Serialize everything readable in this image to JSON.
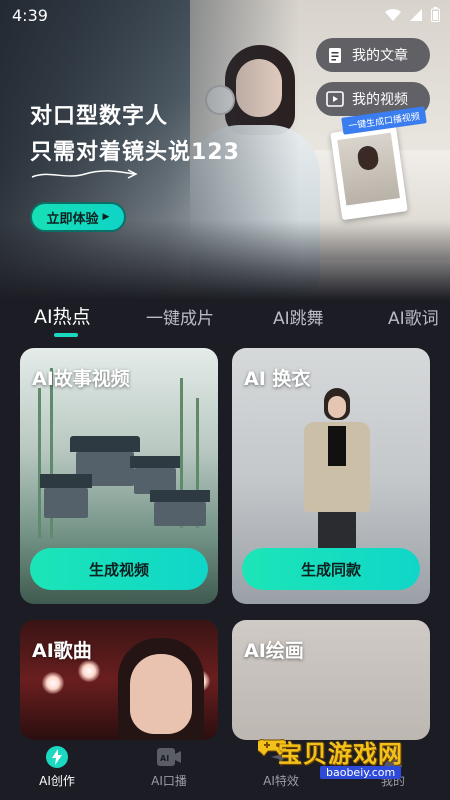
{
  "status_bar": {
    "time": "4:39"
  },
  "hero": {
    "title_line1": "对口型数字人",
    "title_line2": "只需对着镜头说123",
    "cta_label": "立即体验",
    "pill_articles": "我的文章",
    "pill_videos": "我的视频",
    "promo_ribbon": "一键生成口播视频"
  },
  "tabs": [
    {
      "label": "AI热点"
    },
    {
      "label": "一键成片"
    },
    {
      "label": "AI跳舞"
    },
    {
      "label": "AI歌词"
    }
  ],
  "cards": {
    "story": {
      "title": "AI故事视频",
      "button": "生成视频"
    },
    "cloth": {
      "title": "AI 换衣",
      "button": "生成同款"
    },
    "song": {
      "title": "AI歌曲"
    },
    "paint": {
      "title": "AI绘画"
    }
  },
  "bottom_nav": [
    {
      "label": "AI创作"
    },
    {
      "label": "AI口播"
    },
    {
      "label": "AI特效"
    },
    {
      "label": "我的"
    }
  ],
  "watermark": {
    "text": "宝贝游戏网",
    "url": "baobeiy.com"
  },
  "colors": {
    "accent": "#1ad9c0",
    "background": "#1c1d24"
  }
}
